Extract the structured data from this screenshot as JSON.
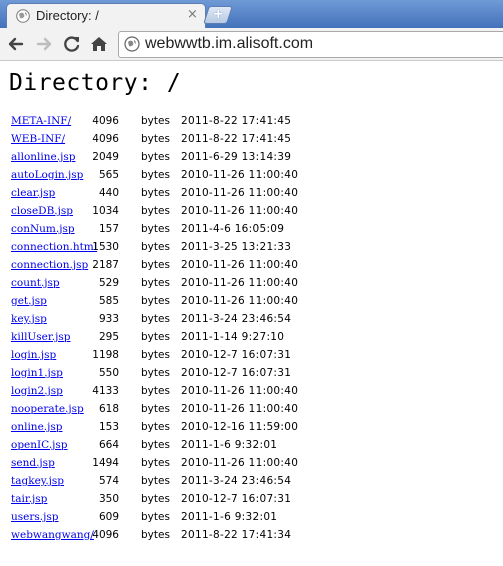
{
  "browser": {
    "tab_title": "Directory: /",
    "tab_close_glyph": "×",
    "new_tab_glyph": "+",
    "url": "webwwtb.im.alisoft.com",
    "icons": [
      "back-icon",
      "forward-icon",
      "reload-icon",
      "home-icon",
      "page-icon"
    ],
    "colors": {
      "tabstrip": "#4d7ec6",
      "link": "#0000ee"
    }
  },
  "page": {
    "heading": "Directory: /",
    "entries": [
      {
        "name": "META-INF/",
        "size": "4096",
        "unit": "bytes",
        "date": "2011-8-22 17:41:45"
      },
      {
        "name": "WEB-INF/",
        "size": "4096",
        "unit": "bytes",
        "date": "2011-8-22 17:41:45"
      },
      {
        "name": "allonline.jsp",
        "size": "2049",
        "unit": "bytes",
        "date": "2011-6-29 13:14:39"
      },
      {
        "name": "autoLogin.jsp",
        "size": "565",
        "unit": "bytes",
        "date": "2010-11-26 11:00:40"
      },
      {
        "name": "clear.jsp",
        "size": "440",
        "unit": "bytes",
        "date": "2010-11-26 11:00:40"
      },
      {
        "name": "closeDB.jsp",
        "size": "1034",
        "unit": "bytes",
        "date": "2010-11-26 11:00:40"
      },
      {
        "name": "conNum.jsp",
        "size": "157",
        "unit": "bytes",
        "date": "2011-4-6 16:05:09"
      },
      {
        "name": "connection.html",
        "size": "1530",
        "unit": "bytes",
        "date": "2011-3-25 13:21:33"
      },
      {
        "name": "connection.jsp",
        "size": "2187",
        "unit": "bytes",
        "date": "2010-11-26 11:00:40"
      },
      {
        "name": "count.jsp",
        "size": "529",
        "unit": "bytes",
        "date": "2010-11-26 11:00:40"
      },
      {
        "name": "get.jsp",
        "size": "585",
        "unit": "bytes",
        "date": "2010-11-26 11:00:40"
      },
      {
        "name": "key.jsp",
        "size": "933",
        "unit": "bytes",
        "date": "2011-3-24 23:46:54"
      },
      {
        "name": "killUser.jsp",
        "size": "295",
        "unit": "bytes",
        "date": "2011-1-14 9:27:10"
      },
      {
        "name": "login.jsp",
        "size": "1198",
        "unit": "bytes",
        "date": "2010-12-7 16:07:31"
      },
      {
        "name": "login1.jsp",
        "size": "550",
        "unit": "bytes",
        "date": "2010-12-7 16:07:31"
      },
      {
        "name": "login2.jsp",
        "size": "4133",
        "unit": "bytes",
        "date": "2010-11-26 11:00:40"
      },
      {
        "name": "nooperate.jsp",
        "size": "618",
        "unit": "bytes",
        "date": "2010-11-26 11:00:40"
      },
      {
        "name": "online.jsp",
        "size": "153",
        "unit": "bytes",
        "date": "2010-12-16 11:59:00"
      },
      {
        "name": "openIC.jsp",
        "size": "664",
        "unit": "bytes",
        "date": "2011-1-6 9:32:01"
      },
      {
        "name": "send.jsp",
        "size": "1494",
        "unit": "bytes",
        "date": "2010-11-26 11:00:40"
      },
      {
        "name": "tagkey.jsp",
        "size": "574",
        "unit": "bytes",
        "date": "2011-3-24 23:46:54"
      },
      {
        "name": "tair.jsp",
        "size": "350",
        "unit": "bytes",
        "date": "2010-12-7 16:07:31"
      },
      {
        "name": "users.jsp",
        "size": "609",
        "unit": "bytes",
        "date": "2011-1-6 9:32:01"
      },
      {
        "name": "webwangwang/",
        "size": "4096",
        "unit": "bytes",
        "date": "2011-8-22 17:41:34"
      }
    ]
  }
}
